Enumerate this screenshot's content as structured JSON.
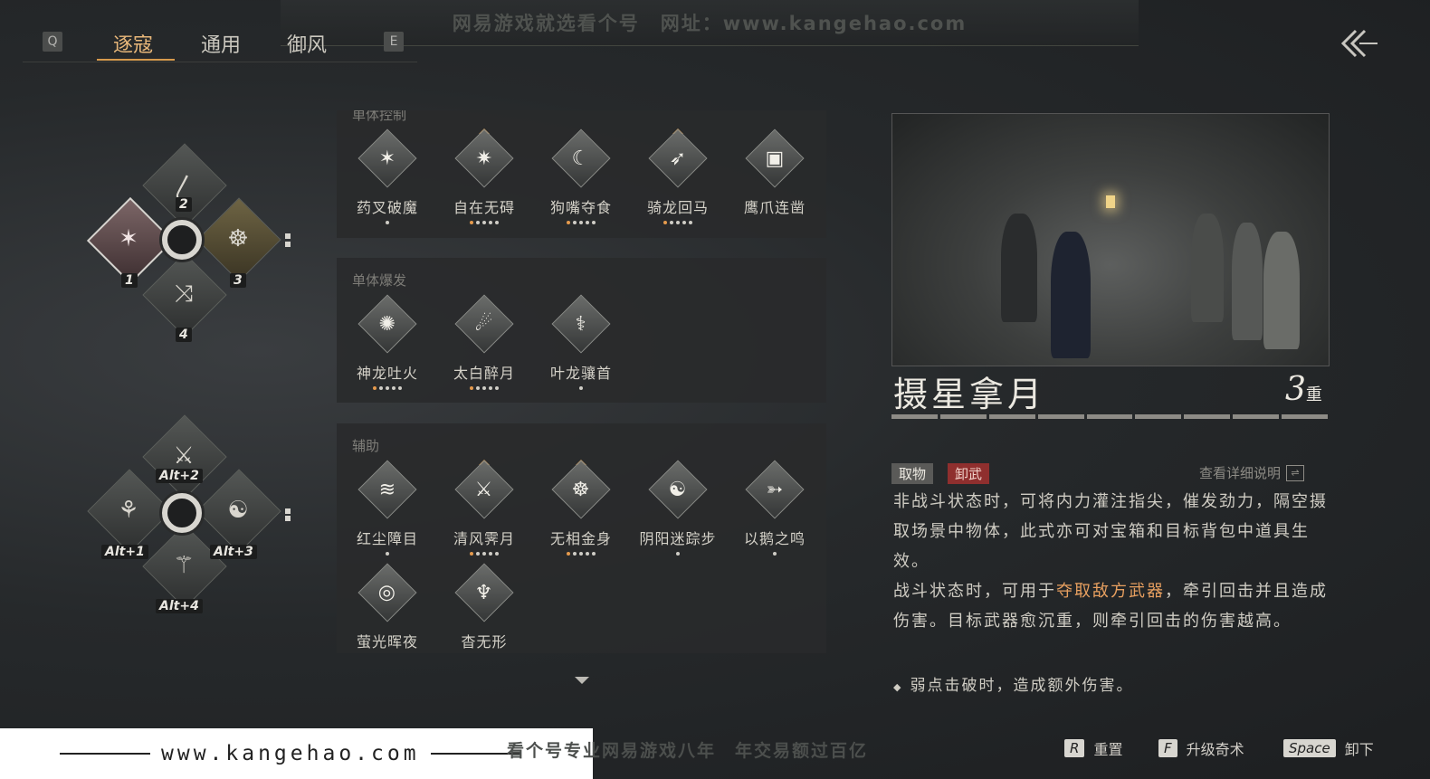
{
  "banner": {
    "top_watermark": "网易游戏就选看个号　网址：www.kangehao.com"
  },
  "tabs": {
    "prev_key": "Q",
    "next_key": "E",
    "items": [
      {
        "label": "逐寇"
      },
      {
        "label": "通用"
      },
      {
        "label": "御风"
      }
    ]
  },
  "loadout": {
    "group1": [
      {
        "key": "1",
        "icon": "blade-slash-icon"
      },
      {
        "key": "2",
        "icon": "staff-icon"
      },
      {
        "key": "3",
        "icon": "figure-spin-icon"
      },
      {
        "key": "4",
        "icon": "spear-lunge-icon"
      }
    ],
    "group2": [
      {
        "mod": "Alt",
        "plus": "+",
        "key": "1",
        "icon": "dancer-icon"
      },
      {
        "mod": "Alt",
        "plus": "+",
        "key": "2",
        "icon": "crossed-blades-icon"
      },
      {
        "mod": "Alt",
        "plus": "+",
        "key": "3",
        "icon": "meditate-icon"
      },
      {
        "mod": "Alt",
        "plus": "+",
        "key": "4",
        "icon": "kick-icon"
      }
    ]
  },
  "sections": [
    {
      "title": "单体控制",
      "skills": [
        {
          "name": "药叉破魔",
          "pips": [
            "w"
          ]
        },
        {
          "name": "自在无碍",
          "crown": true,
          "pips": [
            "o",
            "w",
            "w",
            "w",
            "w"
          ]
        },
        {
          "name": "狗嘴夺食",
          "pips": [
            "o",
            "w",
            "w",
            "w",
            "w"
          ]
        },
        {
          "name": "骑龙回马",
          "crown": true,
          "pips": [
            "o",
            "w",
            "w",
            "w",
            "w"
          ]
        },
        {
          "name": "鹰爪连凿",
          "pips": []
        }
      ]
    },
    {
      "title": "单体爆发",
      "skills": [
        {
          "name": "神龙吐火",
          "pips": [
            "o",
            "w",
            "w",
            "w",
            "w"
          ]
        },
        {
          "name": "太白醉月",
          "pips": [
            "o",
            "w",
            "w",
            "w",
            "w"
          ]
        },
        {
          "name": "叶龙骧首",
          "pips": [
            "w"
          ]
        }
      ]
    },
    {
      "title": "辅助",
      "skills": [
        {
          "name": "红尘障目",
          "pips": [
            "w"
          ]
        },
        {
          "name": "清风霁月",
          "crown": true,
          "pips": [
            "o",
            "w",
            "w",
            "w",
            "w"
          ]
        },
        {
          "name": "无相金身",
          "crown": true,
          "pips": [
            "o",
            "w",
            "w",
            "w",
            "w"
          ]
        },
        {
          "name": "阴阳迷踪步",
          "pips": [
            "w"
          ]
        },
        {
          "name": "以鹅之鸣",
          "pips": [
            "w"
          ]
        },
        {
          "name": "萤光晖夜",
          "pips": []
        },
        {
          "name": "杳无形",
          "pips": []
        }
      ]
    }
  ],
  "detail": {
    "title": "摄星拿月",
    "level_num": "3",
    "level_unit": "重",
    "level_segments": 9,
    "tag_a": "取物",
    "tag_b": "卸武",
    "detail_link": "查看详细说明",
    "desc_1": "非战斗状态时，可将内力灌注指尖，催发劲力，隔空摄取场景中物体，此式亦可对宝箱和目标背包中道具生效。",
    "desc_2_pre": "战斗状态时，可用于",
    "desc_2_hl": "夺取敌方武器",
    "desc_2_post": "，牵引回击并且造成伤害。目标武器愈沉重，则牵引回击的伤害越高。",
    "bullet": "弱点击破时，造成额外伤害。"
  },
  "bottom": {
    "watermark_url": "www.kangehao.com",
    "watermark_slogan": "看个号专业网易游戏八年　年交易额过百亿",
    "hints": [
      {
        "key": "R",
        "label": "重置"
      },
      {
        "key": "F",
        "label": "升级奇术"
      },
      {
        "key": "Space",
        "label": "卸下"
      }
    ]
  },
  "colors": {
    "accent": "#e8b77a",
    "highlight": "#e8a060",
    "tag_red": "#8f2f2e"
  }
}
